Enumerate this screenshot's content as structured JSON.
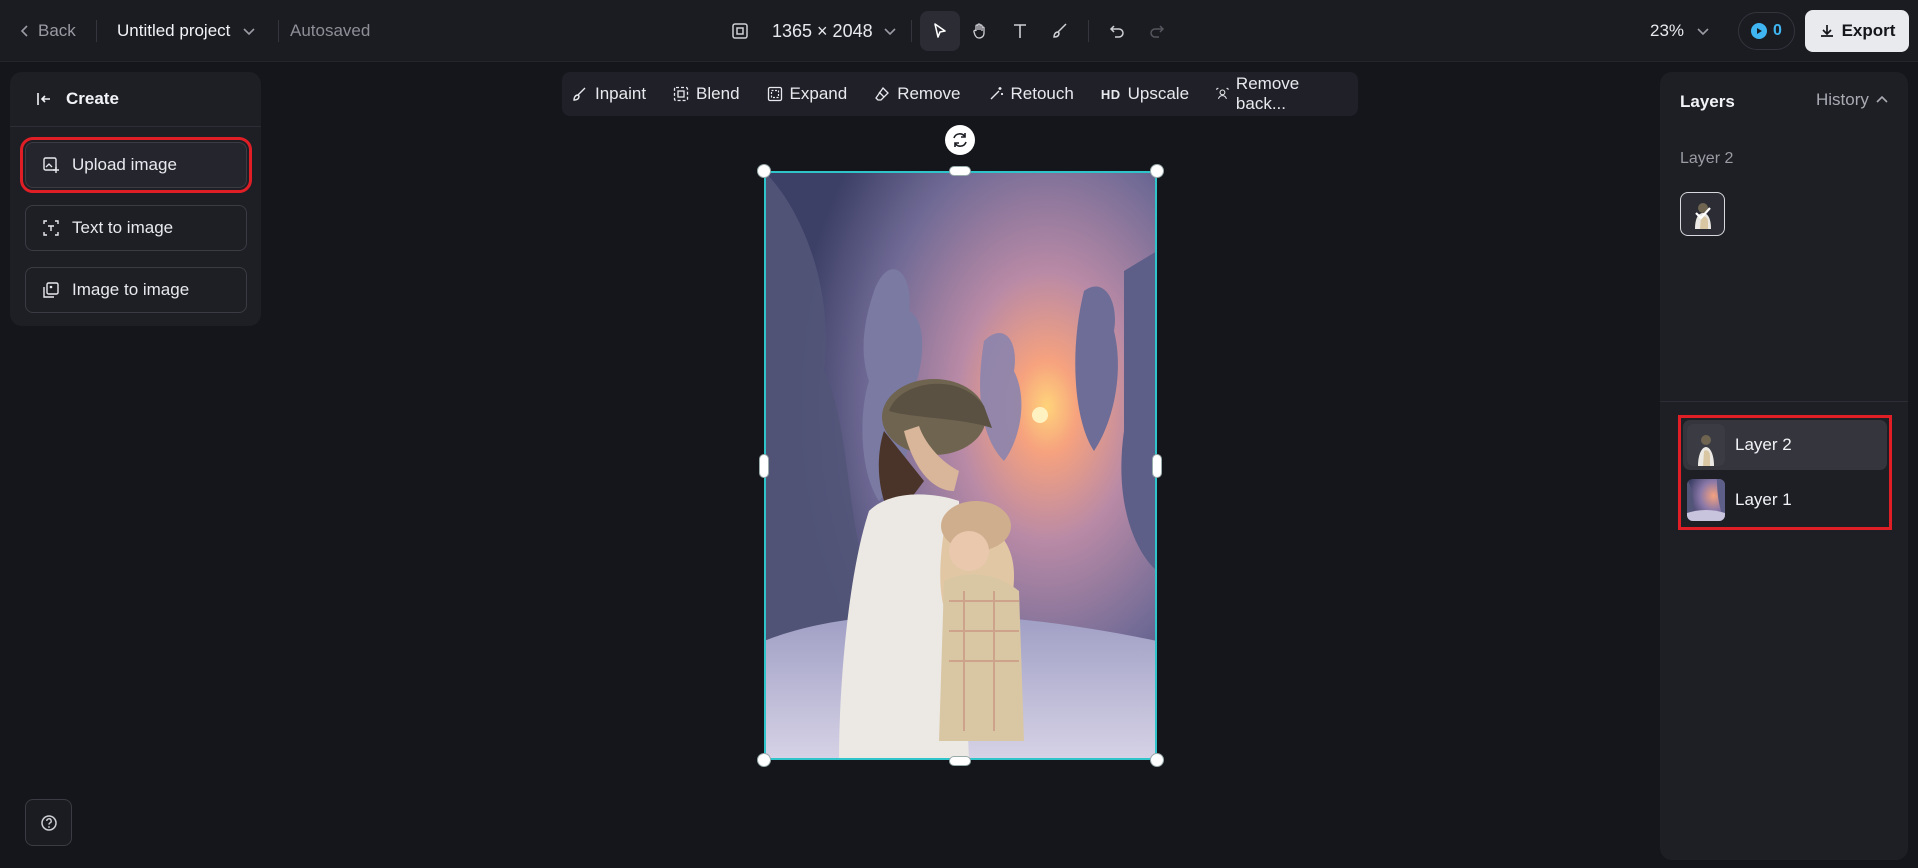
{
  "topbar": {
    "back_label": "Back",
    "project_title": "Untitled project",
    "autosave_status": "Autosaved",
    "canvas_size": "1365 × 2048",
    "zoom_level": "23%",
    "credits_count": "0",
    "export_label": "Export",
    "tools": [
      "select-tool",
      "hand-tool",
      "text-tool",
      "brush-tool",
      "undo",
      "redo"
    ]
  },
  "left_panel": {
    "header": "Create",
    "buttons": [
      {
        "label": "Upload image",
        "highlighted": true
      },
      {
        "label": "Text to image"
      },
      {
        "label": "Image to image"
      }
    ]
  },
  "edit_toolbar": {
    "items": [
      {
        "label": "Inpaint",
        "icon": "inpaint-icon"
      },
      {
        "label": "Blend",
        "icon": "blend-icon"
      },
      {
        "label": "Expand",
        "icon": "expand-icon"
      },
      {
        "label": "Remove",
        "icon": "eraser-icon"
      },
      {
        "label": "Retouch",
        "icon": "retouch-icon"
      },
      {
        "label": "Upscale",
        "icon": "hd-icon",
        "icon_text": "HD"
      },
      {
        "label": "Remove back...",
        "icon": "remove-background-icon"
      }
    ]
  },
  "right_panel": {
    "tab_layers": "Layers",
    "tab_history": "History",
    "selected_layer_name": "Layer 2",
    "layers": [
      {
        "name": "Layer 2",
        "selected": true
      },
      {
        "name": "Layer 1",
        "selected": false
      }
    ]
  },
  "colors": {
    "background": "#15161b",
    "selection": "#2ec4c9",
    "highlight": "#e01e26",
    "accent": "#3fb6f2"
  }
}
